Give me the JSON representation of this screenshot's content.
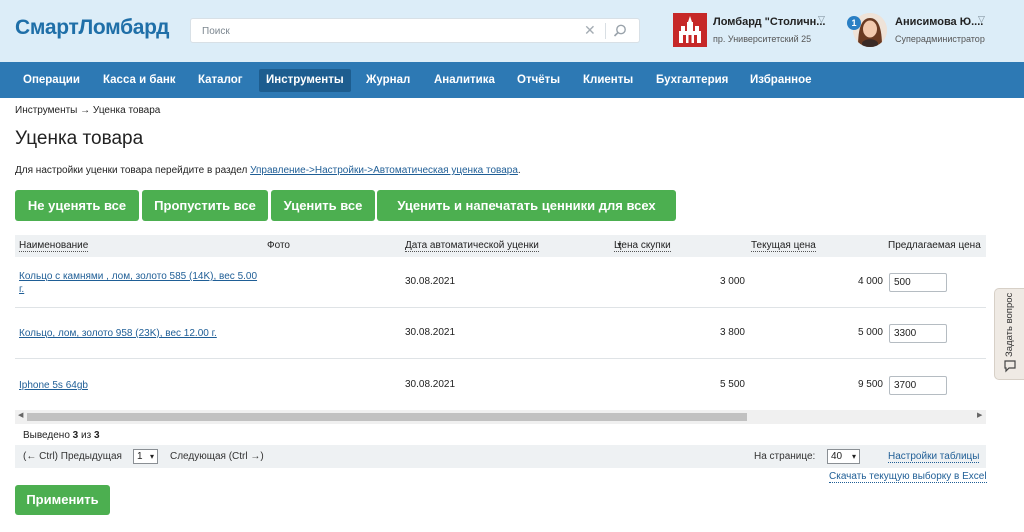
{
  "app": {
    "logo": "СмартЛомбард",
    "search": {
      "placeholder": "Поиск"
    },
    "shop": {
      "name": "Ломбард \"Столичн...",
      "address": "пр. Университетский 25"
    },
    "user": {
      "name": "Анисимова Ю....",
      "role": "Суперадминистратор",
      "notifications": "1"
    }
  },
  "nav": {
    "items": [
      "Операции",
      "Касса и банк",
      "Каталог",
      "Инструменты",
      "Журнал",
      "Аналитика",
      "Отчёты",
      "Клиенты",
      "Бухгалтерия",
      "Избранное"
    ],
    "active": "Инструменты"
  },
  "breadcrumb": "Инструменты → Уценка товара",
  "page_title": "Уценка товара",
  "hint": {
    "text": "Для настройки уценки товара перейдите в раздел ",
    "link": "Управление->Настройки->Автоматическая уценка товара",
    "suffix": "."
  },
  "actions": {
    "no_markdown_all": "Не уценять все",
    "skip_all": "Пропустить все",
    "markdown_all": "Уценить все",
    "markdown_print_all": "Уценить и напечатать ценники для всех"
  },
  "table": {
    "columns": [
      "Наименование",
      "Фото",
      "Дата автоматической уценки",
      "Цена скупки",
      "Текущая цена",
      "Предлагаемая цена"
    ],
    "rows": [
      {
        "name": "Кольцо с камнями , лом, золото 585 (14K), вес 5.00 г.",
        "photo": "",
        "date": "30.08.2021",
        "buy_price": "3 000",
        "current_price": "4 000",
        "proposed_price": "500"
      },
      {
        "name": "Кольцо, лом, золото 958 (23K), вес 12.00 г.",
        "photo": "",
        "date": "30.08.2021",
        "buy_price": "3 800",
        "current_price": "5 000",
        "proposed_price": "3300"
      },
      {
        "name": "Iphone 5s 64gb",
        "photo": "",
        "date": "30.08.2021",
        "buy_price": "5 500",
        "current_price": "9 500",
        "proposed_price": "3700"
      }
    ]
  },
  "footer": {
    "shown_prefix": "Выведено ",
    "shown_count": "3",
    "shown_of": " из ",
    "shown_total": "3",
    "prev": "(← Ctrl) Предыдущая",
    "page": "1",
    "next": "Следующая (Ctrl →)",
    "per_page_label": "На странице:",
    "per_page": "40",
    "table_settings": "Настройки таблицы",
    "excel": "Скачать текущую выборку в Excel"
  },
  "apply_button": "Применить",
  "ask_question": "Задать вопрос",
  "colors": {
    "brand": "#1f6fa8",
    "nav": "#2d79b4",
    "nav_active": "#1d5d8f",
    "success": "#4caf50",
    "link": "#1f5e96"
  }
}
